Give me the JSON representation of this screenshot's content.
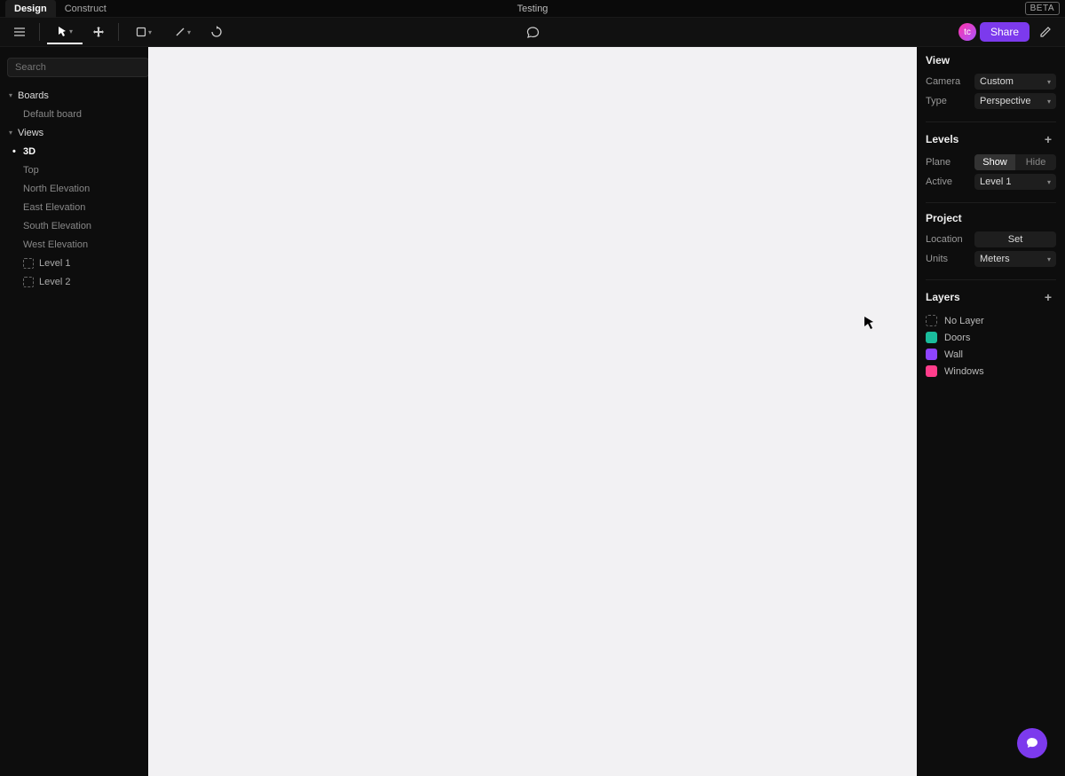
{
  "topbar": {
    "tabs": [
      "Design",
      "Construct"
    ],
    "active_tab": "Design",
    "project_name": "Testing",
    "beta_label": "BETA"
  },
  "toolbar": {
    "share_label": "Share",
    "avatar_initials": "tc"
  },
  "left": {
    "search_placeholder": "Search",
    "boards_header": "Boards",
    "boards": [
      "Default board"
    ],
    "views_header": "Views",
    "views": [
      "3D",
      "Top",
      "North Elevation",
      "East Elevation",
      "South Elevation",
      "West Elevation"
    ],
    "active_view": "3D",
    "levels": [
      "Level 1",
      "Level 2"
    ]
  },
  "right": {
    "view": {
      "title": "View",
      "camera_label": "Camera",
      "camera_value": "Custom",
      "type_label": "Type",
      "type_value": "Perspective"
    },
    "levels": {
      "title": "Levels",
      "plane_label": "Plane",
      "plane_show": "Show",
      "plane_hide": "Hide",
      "active_label": "Active",
      "active_value": "Level 1"
    },
    "project": {
      "title": "Project",
      "location_label": "Location",
      "location_btn": "Set",
      "units_label": "Units",
      "units_value": "Meters"
    },
    "layers": {
      "title": "Layers",
      "items": [
        {
          "name": "No Layer",
          "color": "dashed"
        },
        {
          "name": "Doors",
          "color": "#1abc9c"
        },
        {
          "name": "Wall",
          "color": "#8e44ff"
        },
        {
          "name": "Windows",
          "color": "#ff3d8b"
        }
      ]
    }
  }
}
